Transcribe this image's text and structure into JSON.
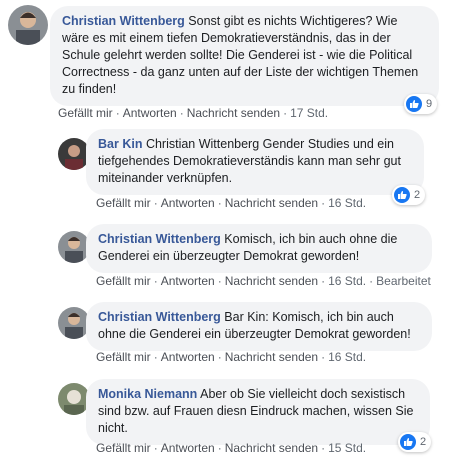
{
  "comments": [
    {
      "author": "Christian Wittenberg",
      "text": "Sonst gibt es nichts Wichtigeres? Wie wäre es mit einem tiefen Demokratieverständnis, das in der Schule gelehrt werden sollte! Die Genderei ist - wie die Political Correctness - da ganz unten auf der Liste der wichtigen Themen zu finden!",
      "like": "Gefällt mir",
      "reply": "Antworten",
      "message": "Nachricht senden",
      "time": "17 Std.",
      "reactions": "9"
    },
    {
      "author": "Bar Kin",
      "text": "Christian Wittenberg Gender Studies und ein tiefgehendes Demokratieverständis kann man sehr gut miteinander verknüpfen.",
      "like": "Gefällt mir",
      "reply": "Antworten",
      "message": "Nachricht senden",
      "time": "16 Std.",
      "reactions": "2"
    },
    {
      "author": "Christian Wittenberg",
      "text": "Komisch, ich bin auch ohne die Genderei ein überzeugter Demokrat geworden!",
      "like": "Gefällt mir",
      "reply": "Antworten",
      "message": "Nachricht senden",
      "time": "16 Std.",
      "edited": "Bearbeitet"
    },
    {
      "author": "Christian Wittenberg",
      "text": "Bar Kin: Komisch, ich bin auch ohne die Genderei ein überzeugter Demokrat geworden!",
      "like": "Gefällt mir",
      "reply": "Antworten",
      "message": "Nachricht senden",
      "time": "16 Std."
    },
    {
      "author": "Monika Niemann",
      "text": "Aber ob Sie vielleicht doch sexistisch sind bzw. auf Frauen diesn Eindruck machen, wissen Sie nicht.",
      "like": "Gefällt mir",
      "reply": "Antworten",
      "message": "Nachricht senden",
      "time": "15 Std.",
      "reactions": "2"
    }
  ],
  "colors": {
    "author": "#385898",
    "bubble": "#f2f3f5",
    "like": "#1877f2"
  }
}
